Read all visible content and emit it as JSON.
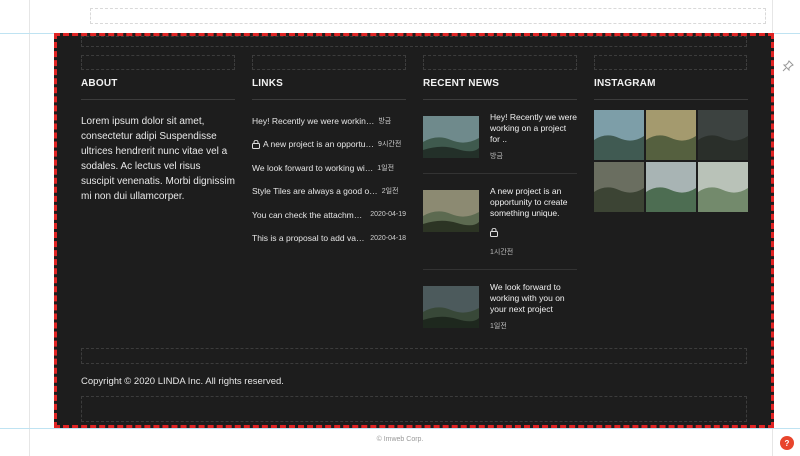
{
  "about": {
    "title": "ABOUT",
    "text": "Lorem ipsum dolor sit amet, consectetur adipi Suspendisse ultrices hendrerit nunc vitae vel a sodales. Ac lectus vel risus suscipit venenatis. Morbi dignissim mi non dui ullamcorper."
  },
  "links": {
    "title": "LINKS",
    "items": [
      {
        "text": "Hey! Recently we were workin…",
        "date": "방금",
        "locked": false
      },
      {
        "text": "A new project is an opportu…",
        "date": "9시간전",
        "locked": true
      },
      {
        "text": "We look forward to working wi…",
        "date": "1일전",
        "locked": false
      },
      {
        "text": "Style Tiles are always a good o…",
        "date": "2일전",
        "locked": false
      },
      {
        "text": "You can check the attachment …",
        "date": "2020-04-19",
        "locked": false
      },
      {
        "text": "This is a proposal to add value …",
        "date": "2020-04-18",
        "locked": false
      }
    ]
  },
  "news": {
    "title": "RECENT NEWS",
    "items": [
      {
        "title": "Hey! Recently we were working on a project for ..",
        "date": "방금",
        "locked": false
      },
      {
        "title": "A new project is an opportunity to create something unique.",
        "date": "1시간전",
        "locked": true
      },
      {
        "title": "We look forward to working with you on your next project",
        "date": "1일전",
        "locked": false
      }
    ]
  },
  "instagram": {
    "title": "INSTAGRAM",
    "photo_count": 6
  },
  "copyright": "Copyright © 2020 LINDA Inc. All rights reserved.",
  "credit": "© Imweb Corp.",
  "help_label": "?",
  "colors": {
    "footer_bg": "#1d1d1d",
    "selection_border": "#e02424",
    "help_button": "#e8452c"
  }
}
